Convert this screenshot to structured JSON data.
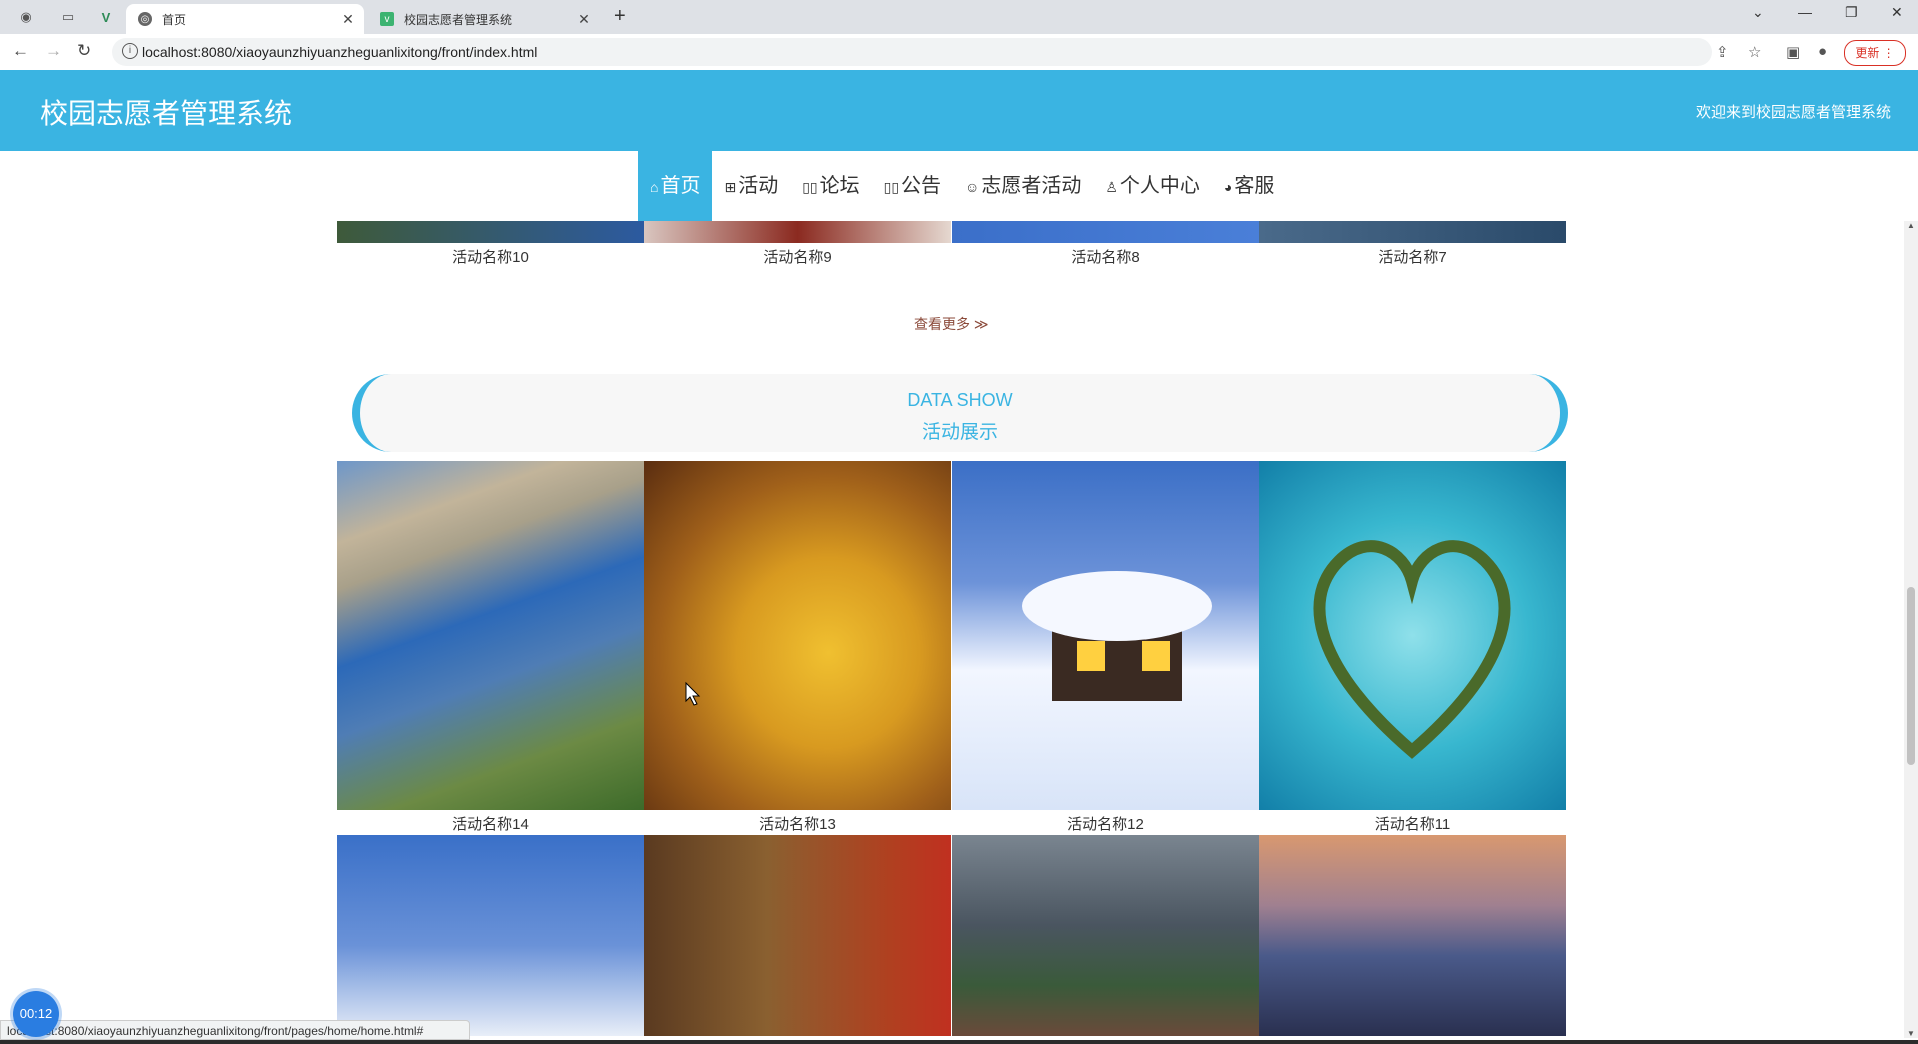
{
  "browser": {
    "tabs": [
      {
        "title": "首页",
        "active": true
      },
      {
        "title": "校园志愿者管理系统",
        "active": false
      }
    ],
    "url": "localhost:8080/xiaoyaunzhiyuanzheguanlixitong/front/index.html",
    "update_label": "更新",
    "status_url": "localhost:8080/xiaoyaunzhiyuanzheguanlixitong/front/pages/home/home.html#",
    "timer": "00:12"
  },
  "header": {
    "title": "校园志愿者管理系统",
    "welcome": "欢迎来到校园志愿者管理系统"
  },
  "nav": [
    {
      "icon": "home-icon",
      "glyph": "⌂",
      "label": "首页",
      "active": true
    },
    {
      "icon": "activity-icon",
      "glyph": "⊞",
      "label": "活动"
    },
    {
      "icon": "forum-icon",
      "glyph": "▯▯",
      "label": "论坛"
    },
    {
      "icon": "notice-icon",
      "glyph": "▯▯",
      "label": "公告"
    },
    {
      "icon": "volunteer-icon",
      "glyph": "☺",
      "label": "志愿者活动"
    },
    {
      "icon": "user-icon",
      "glyph": "♙",
      "label": "个人中心"
    },
    {
      "icon": "service-icon",
      "glyph": "◕",
      "label": "客服"
    }
  ],
  "top_list": {
    "items": [
      "活动名称10",
      "活动名称9",
      "活动名称8",
      "活动名称7"
    ],
    "more_label": "查看更多 ≫"
  },
  "showcase": {
    "title_en": "DATA SHOW",
    "title_zh": "活动展示",
    "row1": [
      "活动名称14",
      "活动名称13",
      "活动名称12",
      "活动名称11"
    ]
  },
  "colors": {
    "primary": "#3ab4e2"
  }
}
